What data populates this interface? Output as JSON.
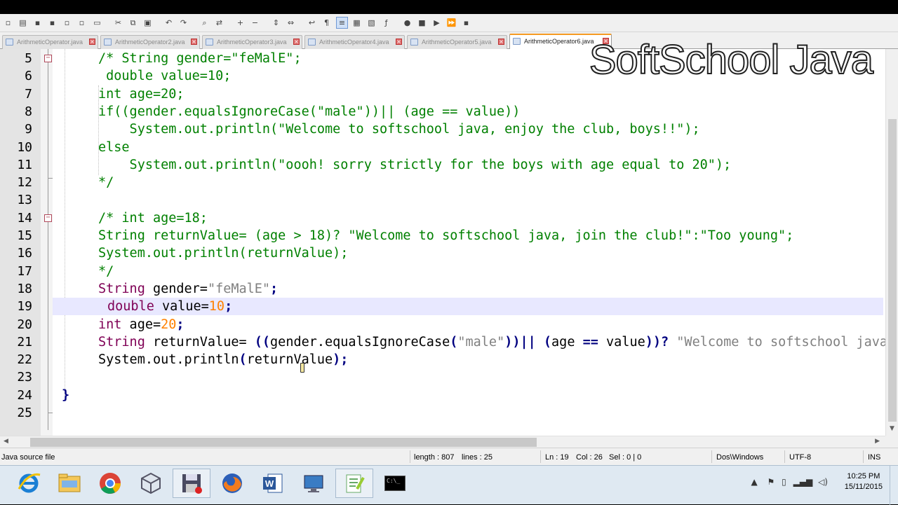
{
  "tabs": [
    {
      "label": "ArithmeticOperator.java",
      "active": false
    },
    {
      "label": "ArithmeticOperator2.java",
      "active": false
    },
    {
      "label": "ArithmeticOperator3.java",
      "active": false
    },
    {
      "label": "ArithmeticOperator4.java",
      "active": false
    },
    {
      "label": "ArithmeticOperator5.java",
      "active": false
    },
    {
      "label": "ArithmeticOperator6.java",
      "active": true
    }
  ],
  "watermark": "SoftSchool Java",
  "editor": {
    "current_line": 19,
    "lines": [
      {
        "n": "5"
      },
      {
        "n": "6"
      },
      {
        "n": "7"
      },
      {
        "n": "8"
      },
      {
        "n": "9"
      },
      {
        "n": "10"
      },
      {
        "n": "11"
      },
      {
        "n": "12"
      },
      {
        "n": "13"
      },
      {
        "n": "14"
      },
      {
        "n": "15"
      },
      {
        "n": "16"
      },
      {
        "n": "17"
      },
      {
        "n": "18"
      },
      {
        "n": "19"
      },
      {
        "n": "20"
      },
      {
        "n": "21"
      },
      {
        "n": "22"
      },
      {
        "n": "23"
      },
      {
        "n": "24"
      },
      {
        "n": "25"
      }
    ],
    "code": {
      "l5": "/* String gender=\"feMalE\";",
      "l6": " double value=10;",
      "l7": "int age=20;",
      "l8": "if((gender.equalsIgnoreCase(\"male\"))|| (age == value))",
      "l9": "    System.out.println(\"Welcome to softschool java, enjoy the club, boys!!\");",
      "l10": "else",
      "l11": "    System.out.println(\"oooh! sorry strictly for the boys with age equal to 20\");",
      "l12": "*/",
      "l14": "/* int age=18;",
      "l15": "String returnValue= (age > 18)? \"Welcome to softschool java, join the club!\":\"Too young\";",
      "l16": "System.out.println(returnValue);",
      "l17": "*/",
      "l18_kw": "String",
      "l18_rest": " gender=",
      "l18_str": "\"feMalE\"",
      "l18_end": ";",
      "l19_kw": "double",
      "l19_rest": " value=",
      "l19_num": "10",
      "l19_end": ";",
      "l20_kw": "int",
      "l20_rest": " age=",
      "l20_num": "20",
      "l20_end": ";",
      "l21_kw": "String",
      "l21_a": " returnValue= ",
      "l21_op1": "((",
      "l21_b": "gender.equalsIgnoreCase",
      "l21_op2": "(",
      "l21_str1": "\"male\"",
      "l21_op3": "))||",
      "l21_c": " ",
      "l21_op4": "(",
      "l21_d": "age",
      "l21_op5": " == ",
      "l21_e": "value",
      "l21_op6": "))?",
      "l21_str2": " \"Welcome to softschool java\"",
      "l22_a": "System.out.println",
      "l22_op1": "(",
      "l22_b": "returnValue",
      "l22_op2": ");",
      "l24": "}"
    }
  },
  "status": {
    "filetype": "Java source file",
    "length": "length : 807",
    "lines": "lines : 25",
    "ln": "Ln : 19",
    "col": "Col : 26",
    "sel": "Sel : 0 | 0",
    "eol": "Dos\\Windows",
    "encoding": "UTF-8",
    "mode": "INS"
  },
  "taskbar": {
    "time": "10:25 PM",
    "date": "15/11/2015",
    "apps": [
      "internet-explorer",
      "file-explorer",
      "chrome",
      "virtualbox",
      "save-disk",
      "firefox",
      "word",
      "remote-desktop",
      "notepad-plus-plus",
      "command-prompt"
    ],
    "cmd_glyph": "C:\\_"
  }
}
